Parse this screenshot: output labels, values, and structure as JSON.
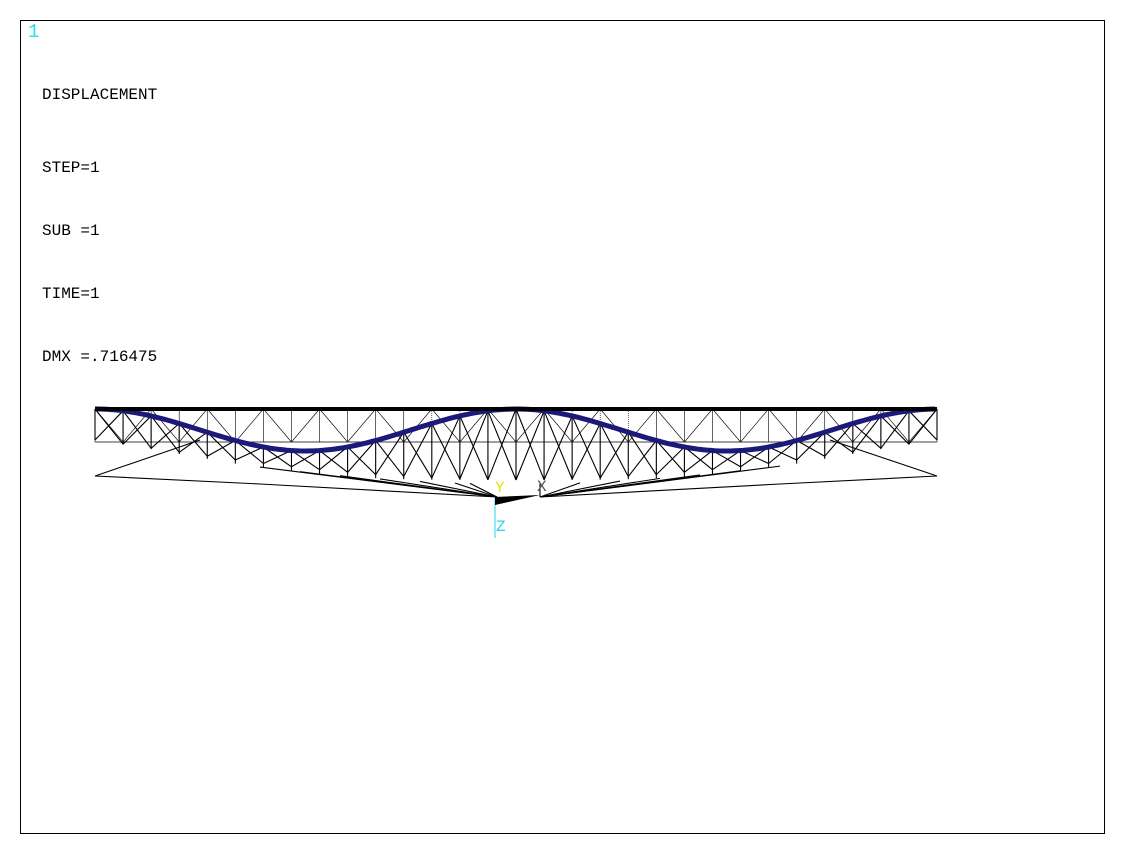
{
  "window": {
    "number": "1"
  },
  "annotation": {
    "title": "DISPLACEMENT",
    "step": "STEP=1",
    "sub": "SUB =1",
    "time": "TIME=1",
    "dmx": "DMX =.716475"
  },
  "triad": {
    "z_label": "Z",
    "y_label": "Y",
    "x_label": "X",
    "color_z": "#22d4f0",
    "color_y": "#e6e600",
    "color_x": "#555555"
  },
  "colors": {
    "undeformed": "#000000",
    "deformed_curve": "#1a1a7a",
    "window_number": "#22e0f0"
  }
}
